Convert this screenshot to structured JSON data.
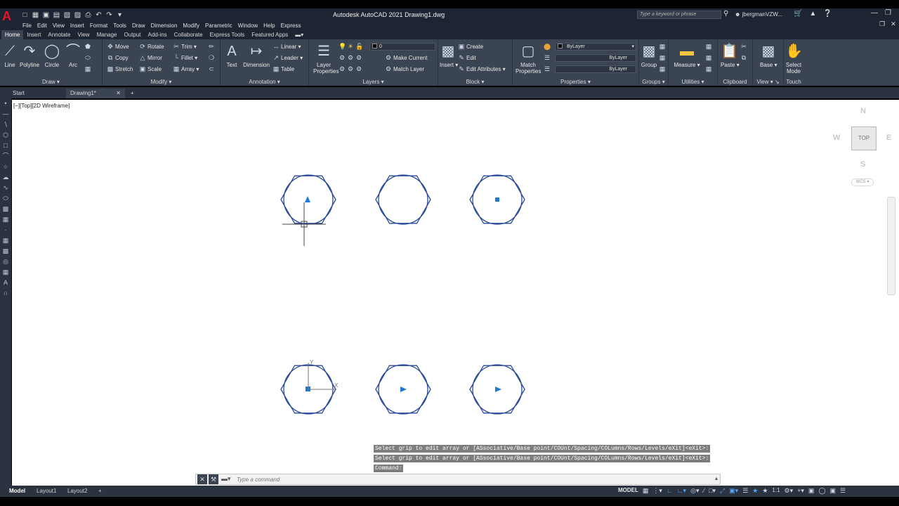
{
  "app": {
    "title": "Autodesk AutoCAD 2021    Drawing1.dwg",
    "logo": "A",
    "search_placeholder": "Type a keyword or phrase",
    "user": "jbergmanVZW..."
  },
  "menu": [
    "File",
    "Edit",
    "View",
    "Insert",
    "Format",
    "Tools",
    "Draw",
    "Dimension",
    "Modify",
    "Parametric",
    "Window",
    "Help",
    "Express"
  ],
  "ribbon_tabs": [
    "Home",
    "Insert",
    "Annotate",
    "View",
    "Manage",
    "Output",
    "Add-ins",
    "Collaborate",
    "Express Tools",
    "Featured Apps"
  ],
  "active_tab": "Home",
  "draw": {
    "title": "Draw",
    "line": "Line",
    "polyline": "Polyline",
    "circle": "Circle",
    "arc": "Arc"
  },
  "modify": {
    "title": "Modify",
    "move": "Move",
    "rotate": "Rotate",
    "trim": "Trim",
    "copy": "Copy",
    "mirror": "Mirror",
    "fillet": "Fillet",
    "stretch": "Stretch",
    "scale": "Scale",
    "array": "Array"
  },
  "annotation": {
    "title": "Annotation",
    "text": "Text",
    "dimension": "Dimension",
    "linear": "Linear",
    "leader": "Leader",
    "table": "Table"
  },
  "layers": {
    "title": "Layers",
    "layer_properties": "Layer\nProperties",
    "layer_value": "0",
    "make_current": "Make Current",
    "match_layer": "Match Layer"
  },
  "block": {
    "title": "Block",
    "insert": "Insert",
    "create": "Create",
    "edit": "Edit",
    "edit_attributes": "Edit Attributes"
  },
  "properties": {
    "title": "Properties",
    "match_properties": "Match\nProperties",
    "color": "ByLayer",
    "linetype": "ByLayer",
    "lineweight": "ByLayer"
  },
  "groups": {
    "title": "Groups",
    "group": "Group"
  },
  "utilities": {
    "title": "Utilities",
    "measure": "Measure"
  },
  "clipboard": {
    "title": "Clipboard",
    "paste": "Paste"
  },
  "view_panel": {
    "title": "View",
    "base": "Base"
  },
  "touch": {
    "title": "Touch",
    "select_mode": "Select\nMode"
  },
  "doc_tabs": {
    "start": "Start",
    "drawing": "Drawing1*"
  },
  "viewport_label": "[−][Top][2D Wireframe]",
  "viewcube": {
    "n": "N",
    "s": "S",
    "e": "E",
    "w": "W",
    "face": "TOP",
    "wcs": "WCS"
  },
  "command": {
    "history": [
      "Select grip to edit array or [ASsociative/Base point/COUnt/Spacing/COLumns/Rows/Levels/eXit]<eXit>:",
      "Select grip to edit array or [ASsociative/Base point/COUnt/Spacing/COLumns/Rows/Levels/eXit]<eXit>:",
      "Command:"
    ],
    "placeholder": "Type a command"
  },
  "layout_tabs": [
    "Model",
    "Layout1",
    "Layout2"
  ],
  "status": {
    "model": "MODEL",
    "scale": "1:1"
  },
  "colors": {
    "canvas": "#ffffff",
    "ribbon": "#3b4453",
    "titlebar": "#1e2532",
    "hexagon": "#2b4a9a",
    "grip": "#1e7ad6"
  }
}
